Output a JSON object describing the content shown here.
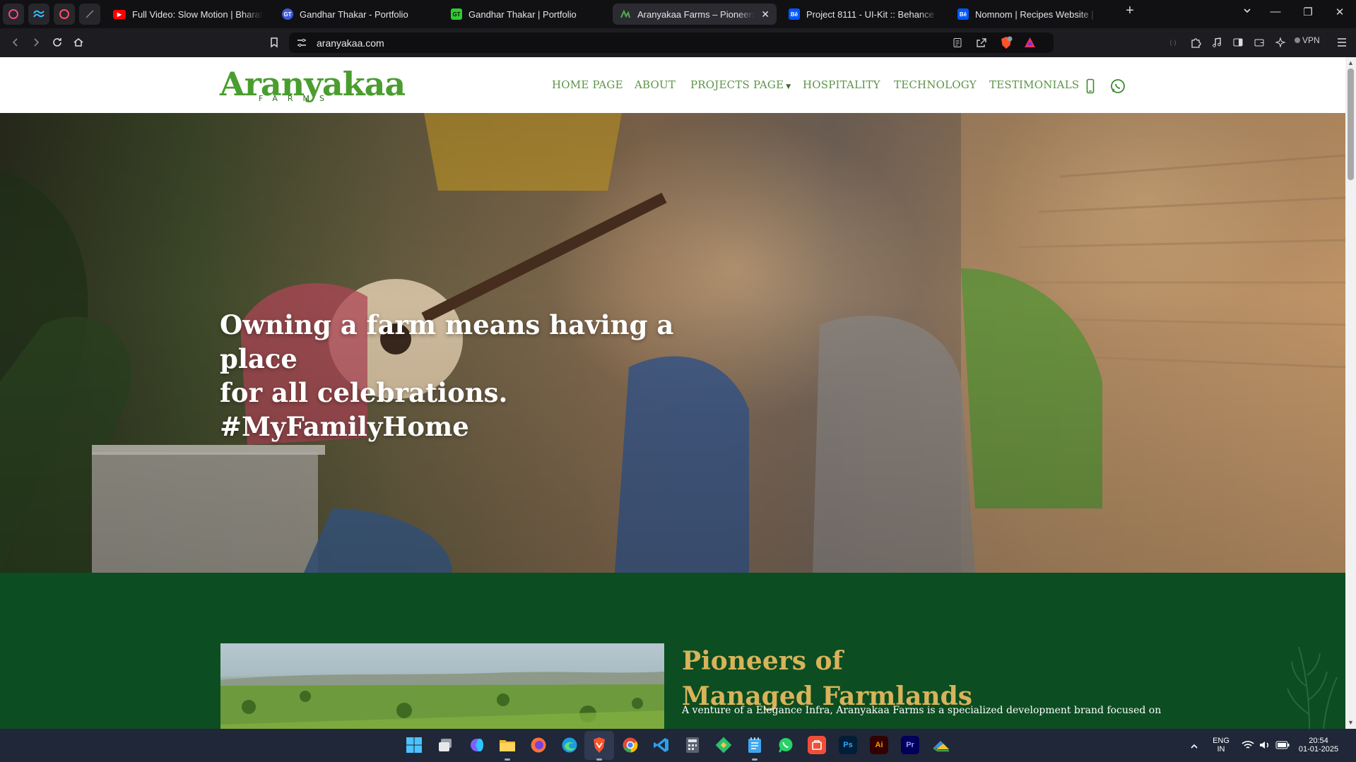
{
  "browser": {
    "tabs": [
      {
        "title": "Full Video: Slow Motion | Bharat | Sa",
        "favicon": "youtube-icon",
        "color": "#ff0000"
      },
      {
        "title": "Gandhar Thakar - Portfolio",
        "favicon": "gt-portfolio-icon",
        "color": "#3b5bdb",
        "fav_text": "GT"
      },
      {
        "title": "Gandhar Thakar | Portfolio",
        "favicon": "gt-portfolio-icon",
        "color": "#2ecc2e",
        "fav_text": "GT"
      },
      {
        "title": "Aranyakaa Farms – Pioneers of Managed Farmlands",
        "favicon": "aranyakaa-icon",
        "color": "#2e7d32",
        "active": true
      },
      {
        "title": "Project 8111 - UI-Kit :: Behance",
        "favicon": "behance-icon",
        "color": "#0057ff",
        "fav_text": "Bē"
      },
      {
        "title": "Nomnom | Recipes Website | UX/UI",
        "favicon": "behance-icon",
        "color": "#0057ff",
        "fav_text": "Bē"
      }
    ],
    "url": "aranyakaa.com",
    "vpn_label": "VPN"
  },
  "site": {
    "brand": {
      "name": "Aranyakaa",
      "sub": "FARMS",
      "color": "#4a9d2f"
    },
    "nav": [
      "HOME PAGE",
      "ABOUT",
      "PROJECTS PAGE",
      "HOSPITALITY",
      "TECHNOLOGY",
      "TESTIMONIALS"
    ],
    "hero": {
      "line1": "Owning a farm means having a place",
      "line2": "for all celebrations. #MyFamilyHome"
    },
    "about": {
      "title_line1": "Pioneers of",
      "title_line2": "Managed Farmlands",
      "text": "A venture of a Elegance Infra, Aranyakaa Farms is a specialized development brand focused on",
      "bg_color": "#0c4d22",
      "title_color": "#d8b35a"
    }
  },
  "taskbar": {
    "apps": [
      "windows-start-icon",
      "task-view-icon",
      "copilot-icon",
      "file-explorer-icon",
      "firefox-icon",
      "edge-icon",
      "brave-icon",
      "chrome-icon",
      "vscode-icon",
      "calculator-icon",
      "git-icon",
      "notepad-icon",
      "whatsapp-icon",
      "app-icon",
      "photoshop-icon",
      "illustrator-icon",
      "premiere-icon",
      "onedrive-icon"
    ],
    "lang_line1": "ENG",
    "lang_line2": "IN",
    "time": "20:54",
    "date": "01-01-2025"
  }
}
